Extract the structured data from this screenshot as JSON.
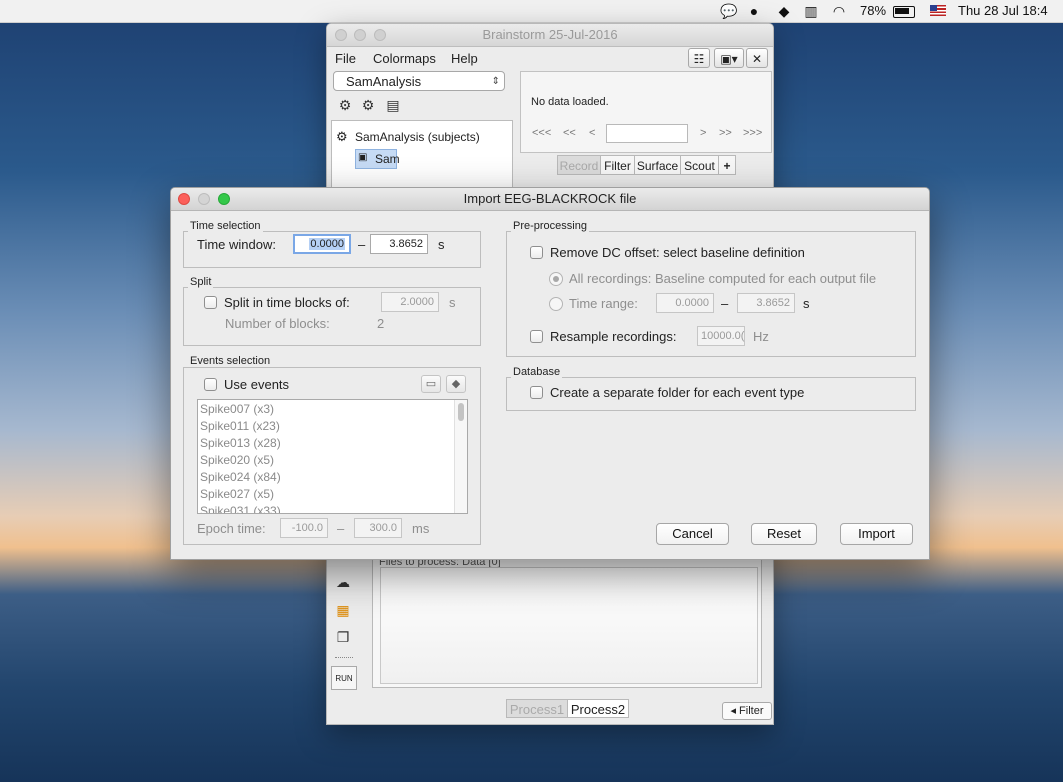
{
  "menubar": {
    "battery": "78%",
    "clock": "Thu 28 Jul  18:4",
    "icons": [
      "wechat-icon",
      "bowler-hat-icon",
      "dropbox-icon",
      "battery-status-icon",
      "wifi-icon",
      "battery-icon",
      "us-flag-icon"
    ]
  },
  "main": {
    "title": "Brainstorm 25-Jul-2016",
    "menu": [
      "File",
      "Colormaps",
      "Help"
    ],
    "protocol": "SamAnalysis",
    "tree": {
      "root": "SamAnalysis (subjects)",
      "child": "Sam"
    },
    "no_data": "No data loaded.",
    "nav": [
      "<<<",
      "<<",
      "<",
      ">",
      ">>",
      ">>>"
    ],
    "tabs": [
      "Record",
      "Filter",
      "Surface",
      "Scout",
      "+"
    ],
    "files_label": "Files to process: Data [0]",
    "run": "RUN",
    "process_tabs": [
      "Process1",
      "Process2"
    ],
    "filter_btn": "◂ Filter"
  },
  "dialog": {
    "title": "Import EEG-BLACKROCK file",
    "time_selection": {
      "group": "Time selection",
      "label": "Time window:",
      "start": "0.0000",
      "dash": "–",
      "end": "3.8652",
      "unit": "s"
    },
    "split": {
      "group": "Split",
      "label": "Split in time blocks of:",
      "value": "2.0000",
      "unit": "s",
      "blocks_label": "Number of blocks:",
      "blocks_value": "2"
    },
    "events": {
      "group": "Events selection",
      "use_events": "Use events",
      "items": [
        "Spike007 (x3)",
        "Spike011 (x23)",
        "Spike013 (x28)",
        "Spike020 (x5)",
        "Spike024 (x84)",
        "Spike027 (x5)",
        "Spike031 (x33)"
      ],
      "epoch_label": "Epoch time:",
      "epoch_start": "-100.0",
      "dash": "–",
      "epoch_end": "300.0",
      "epoch_unit": "ms"
    },
    "preprocessing": {
      "group": "Pre-processing",
      "dc_offset": "Remove DC offset: select baseline definition",
      "all_recordings": "All recordings: Baseline computed for each output file",
      "time_range_label": "Time range:",
      "range_start": "0.0000",
      "dash": "–",
      "range_end": "3.8652",
      "range_unit": "s",
      "resample": "Resample recordings:",
      "resample_value": "10000.0(",
      "resample_unit": "Hz"
    },
    "database": {
      "group": "Database",
      "separate_folder": "Create a separate folder for each event type"
    },
    "buttons": {
      "cancel": "Cancel",
      "reset": "Reset",
      "import": "Import"
    }
  }
}
